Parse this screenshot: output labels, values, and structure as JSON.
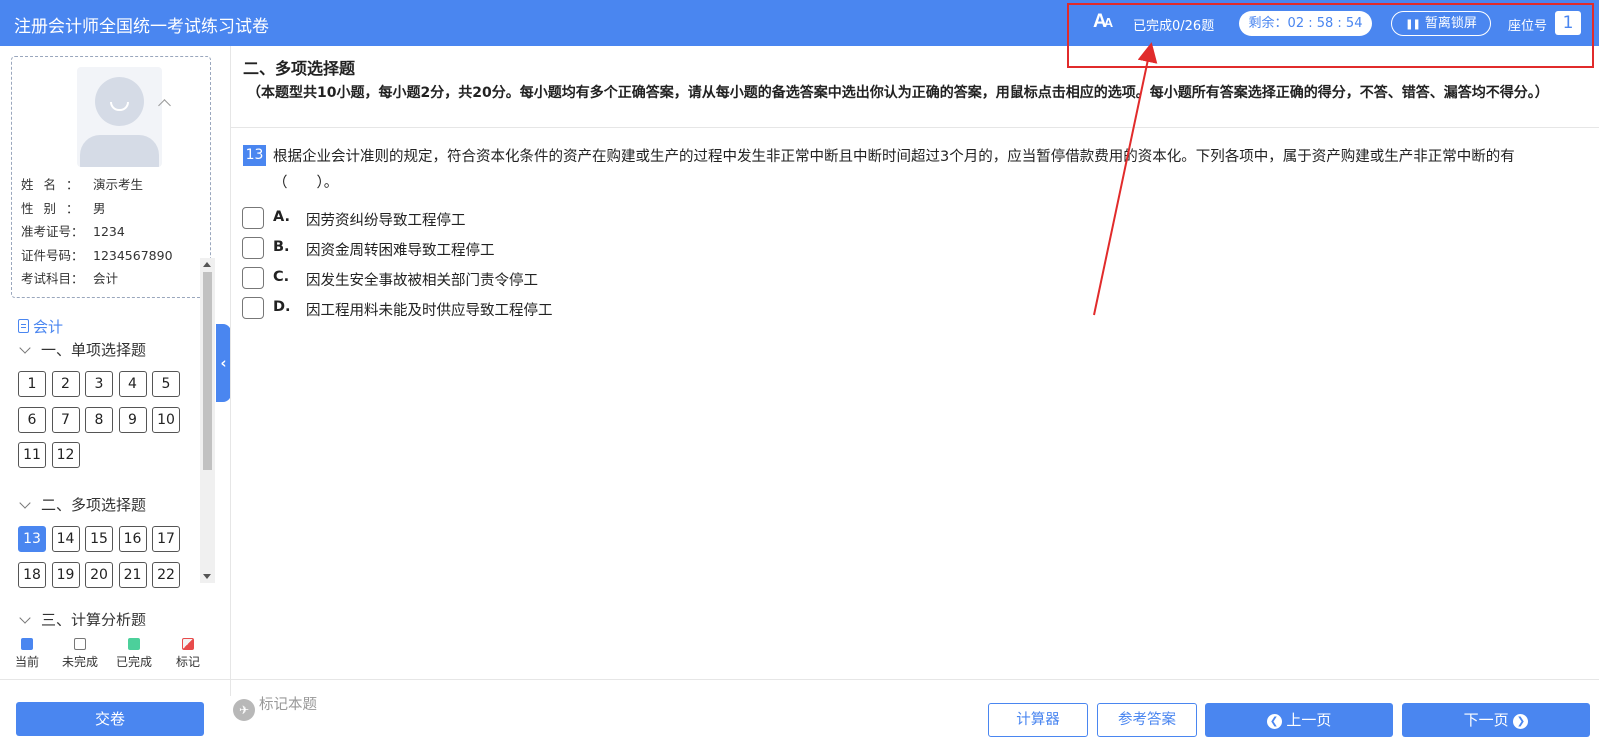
{
  "header": {
    "title": "注册会计师全国统一考试练习试卷",
    "font_icon": "font-size-icon",
    "completed": "已完成0/26题",
    "timer_label": "剩余：",
    "timer_value": "02 : 58 : 54",
    "lock_label": "暂离锁屏",
    "seat_label": "座位号",
    "seat_number": "1"
  },
  "candidate": {
    "rows": [
      {
        "key": "姓名：",
        "value": "演示考生"
      },
      {
        "key": "性别：",
        "value": "男"
      },
      {
        "key": "准考证号：",
        "value": "1234"
      },
      {
        "key": "证件号码：",
        "value": "1234567890"
      },
      {
        "key": "考试科目：",
        "value": "会计"
      }
    ]
  },
  "nav": {
    "subject": "会计",
    "sections": [
      {
        "title": "一、单项选择题",
        "questions": [
          "1",
          "2",
          "3",
          "4",
          "5",
          "6",
          "7",
          "8",
          "9",
          "10",
          "11",
          "12"
        ]
      },
      {
        "title": "二、多项选择题",
        "questions": [
          "13",
          "14",
          "15",
          "16",
          "17",
          "18",
          "19",
          "20",
          "21",
          "22"
        ]
      },
      {
        "title": "三、计算分析题",
        "questions": []
      }
    ],
    "current_question": "13"
  },
  "legend": [
    {
      "label": "当前",
      "kind": "cur"
    },
    {
      "label": "未完成",
      "kind": "todo"
    },
    {
      "label": "已完成",
      "kind": "done"
    },
    {
      "label": "标记",
      "kind": "mark"
    }
  ],
  "main": {
    "section_title": "二、多项选择题",
    "section_desc": "（本题型共10小题，每小题2分，共20分。每小题均有多个正确答案，请从每小题的备选答案中选出你认为正确的答案，用鼠标点击相应的选项。每小题所有答案选择正确的得分，不答、错答、漏答均不得分。）",
    "question_number": "13",
    "question_text": "根据企业会计准则的规定，符合资本化条件的资产在购建或生产的过程中发生非正常中断且中断时间超过3个月的，应当暂停借款费用的资本化。下列各项中，属于资产购建或生产非正常中断的有（　　）。",
    "options": [
      {
        "letter": "A.",
        "text": "因劳资纠纷导致工程停工"
      },
      {
        "letter": "B.",
        "text": "因资金周转困难导致工程停工"
      },
      {
        "letter": "C.",
        "text": "因发生安全事故被相关部门责令停工"
      },
      {
        "letter": "D.",
        "text": "因工程用料未能及时供应导致工程停工"
      }
    ]
  },
  "footer": {
    "submit": "交卷",
    "mark": "标记本题",
    "calculator": "计算器",
    "answer": "参考答案",
    "prev": "上一页",
    "next": "下一页"
  },
  "colors": {
    "primary": "#4a86f0",
    "annotation": "#e12b2b",
    "done": "#4cd09b"
  }
}
